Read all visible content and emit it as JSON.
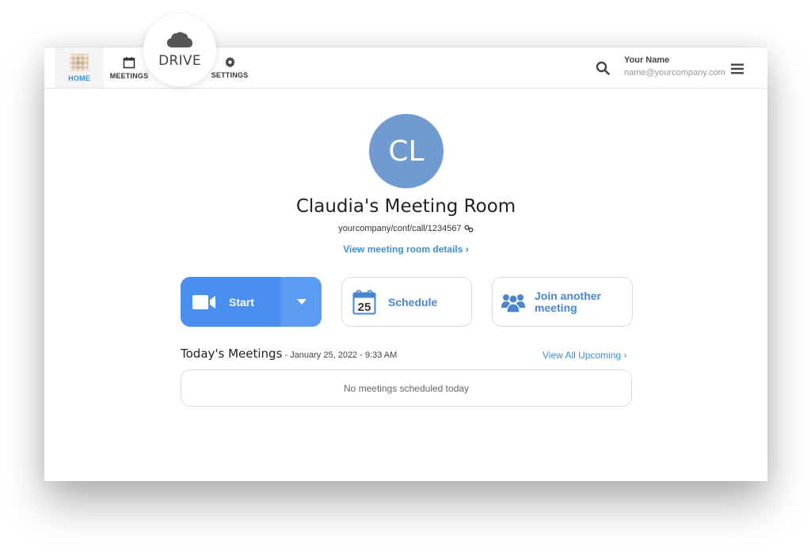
{
  "nav": {
    "items": [
      {
        "label": "HOME",
        "icon": "home-icon",
        "active": true
      },
      {
        "label": "MEETINGS",
        "icon": "calendar-icon"
      },
      {
        "label": "DRIVE",
        "icon": "cloud-icon",
        "highlighted": true
      },
      {
        "label": "SETTINGS",
        "icon": "gear-icon"
      }
    ]
  },
  "user": {
    "name": "Your Name",
    "email": "name@yourcompany.com"
  },
  "room": {
    "initials": "CL",
    "title": "Claudia's Meeting Room",
    "url": "yourcompany/conf/call/1234567",
    "details_link": "View meeting room details ›"
  },
  "actions": {
    "start_label": "Start",
    "schedule_label": "Schedule",
    "schedule_day": "25",
    "join_label_line1": "Join another",
    "join_label_line2": "meeting"
  },
  "today": {
    "heading": "Today's Meetings",
    "date": " - January 25, 2022 - 9:33 AM",
    "view_all": "View All Upcoming ›",
    "empty_message": "No meetings scheduled today"
  },
  "colors": {
    "accent": "#3c8fd6",
    "start_button": "#4a8ff0",
    "avatar": "#6f9bd1"
  }
}
